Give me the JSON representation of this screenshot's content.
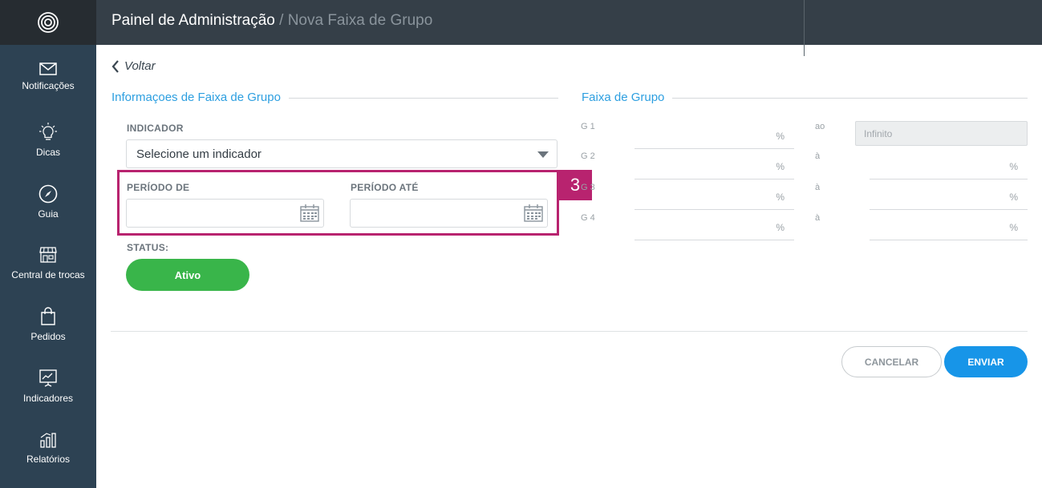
{
  "header": {
    "title": "Painel de Administração",
    "separator": "/",
    "subtitle": "Nova Faixa de Grupo"
  },
  "sidebar": {
    "items": [
      {
        "label": "Notificações",
        "icon": "envelope-icon"
      },
      {
        "label": "Dicas",
        "icon": "lightbulb-icon"
      },
      {
        "label": "Guia",
        "icon": "compass-icon"
      },
      {
        "label": "Central de trocas",
        "icon": "storefront-icon"
      },
      {
        "label": "Pedidos",
        "icon": "shopping-bag-icon"
      },
      {
        "label": "Indicadores",
        "icon": "presentation-chart-icon"
      },
      {
        "label": "Relatórios",
        "icon": "bar-chart-icon"
      }
    ]
  },
  "main": {
    "back_label": "Voltar",
    "info_section_title": "Informaçoes de Faixa de Grupo",
    "indicator_label": "INDICADOR",
    "indicator_value": "Selecione um indicador",
    "period_from_label": "PERÍODO DE",
    "period_to_label": "PERÍODO ATÉ",
    "period_from_value": "",
    "period_to_value": "",
    "status_label": "STATUS:",
    "status_value": "Ativo",
    "highlight_badge": "3",
    "cancel_label": "CANCELAR",
    "send_label": "ENVIAR"
  },
  "group_range": {
    "title": "Faixa de Grupo",
    "rows": [
      {
        "label": "G 1",
        "unit": "%",
        "to_label": "ao",
        "to_value": "Infinito"
      },
      {
        "label": "G 2",
        "unit": "%",
        "to_label": "à",
        "to_unit": "%"
      },
      {
        "label": "G 3",
        "unit": "%",
        "to_label": "à",
        "to_unit": "%"
      },
      {
        "label": "G 4",
        "unit": "%",
        "to_label": "à",
        "to_unit": "%"
      }
    ]
  },
  "colors": {
    "sidebar": "#2d4253",
    "header": "#353f48",
    "accent_blue": "#2d9fe0",
    "send_button": "#1795e8",
    "status_green": "#39b54a",
    "highlight": "#b8236f"
  }
}
